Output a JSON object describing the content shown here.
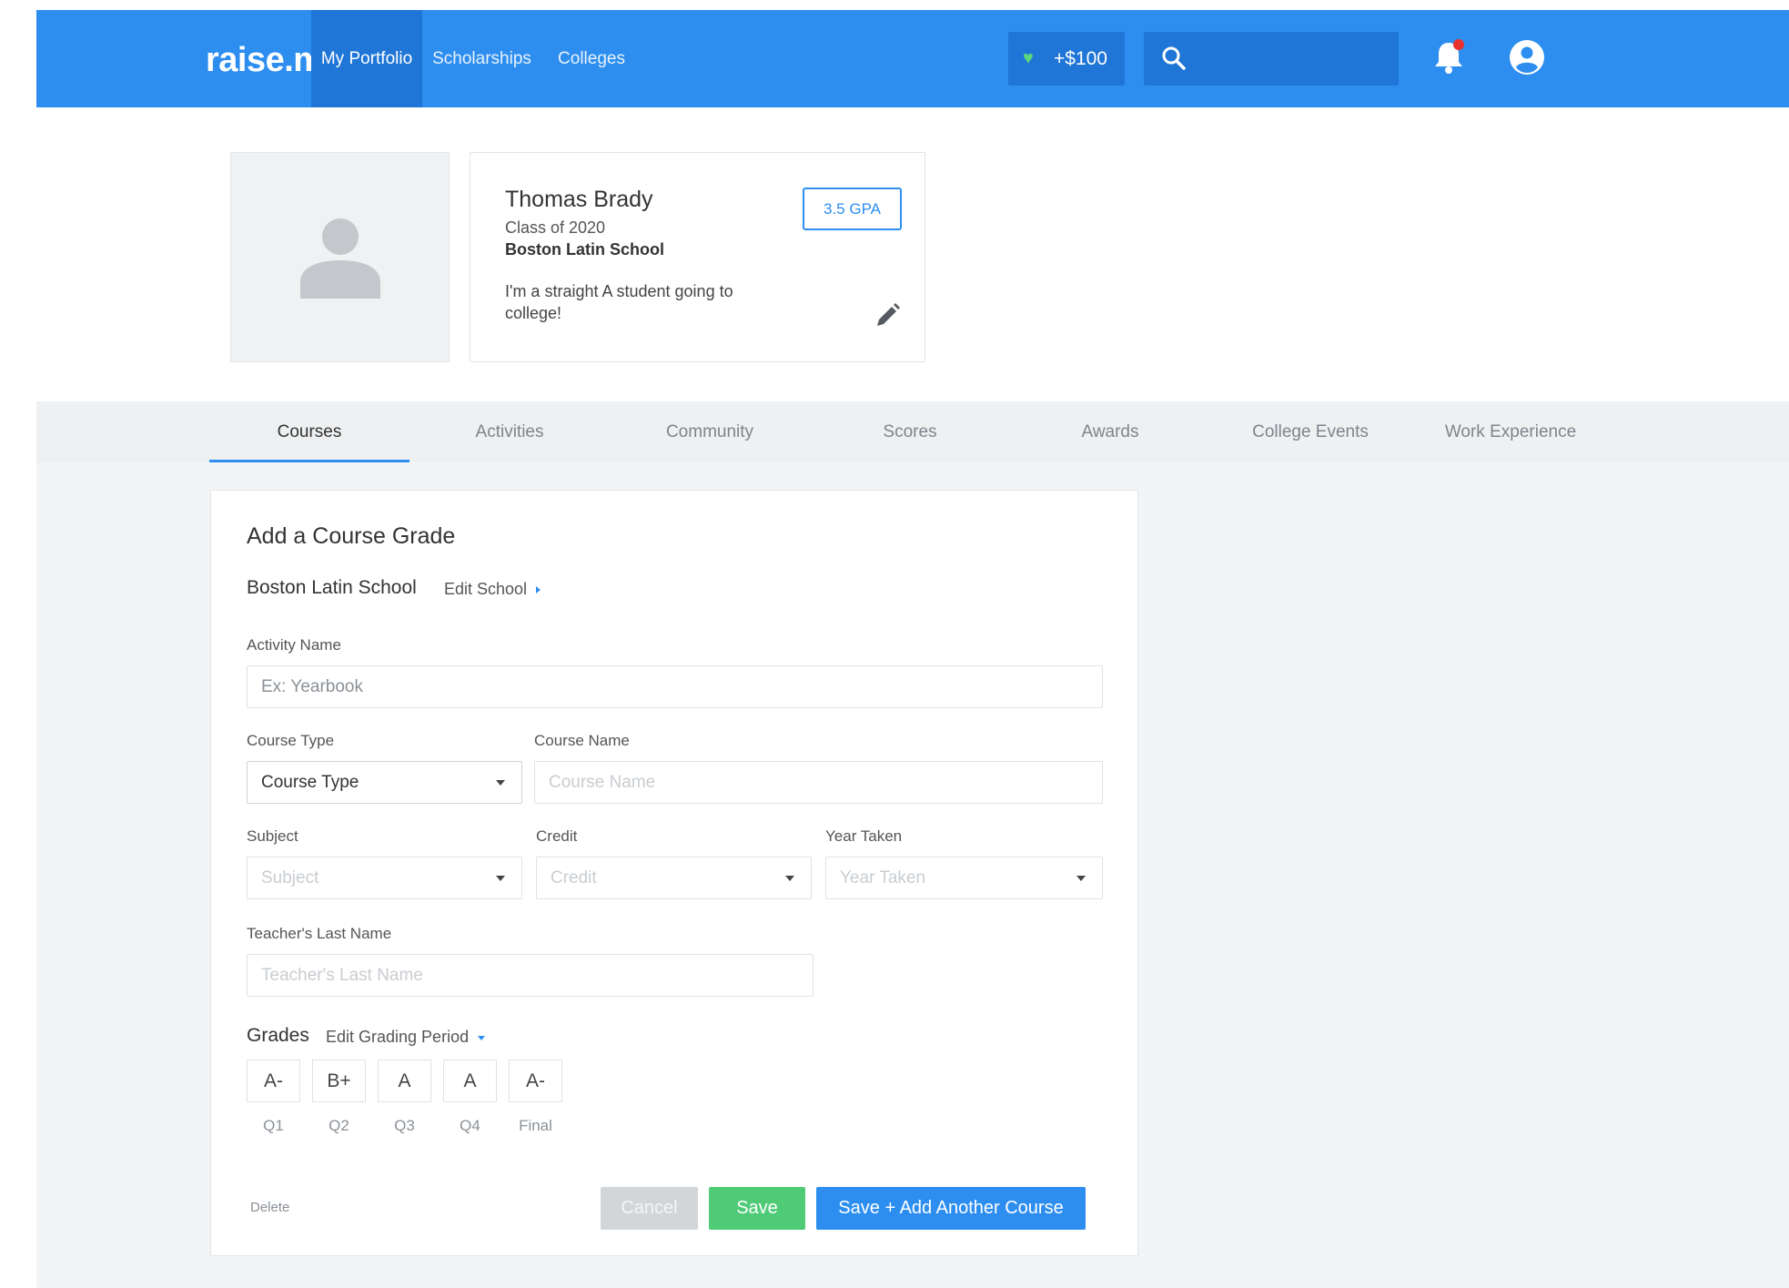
{
  "nav": {
    "logo": "raise.me",
    "links": [
      "My Portfolio",
      "Scholarships",
      "Colleges"
    ],
    "reward": "+$100"
  },
  "profile": {
    "name": "Thomas Brady",
    "class_of": "Class of 2020",
    "school": "Boston Latin School",
    "bio": "I'm a straight A student going to college!",
    "gpa": "3.5 GPA"
  },
  "tabs": [
    "Courses",
    "Activities",
    "Community",
    "Scores",
    "Awards",
    "College Events",
    "Work Experience"
  ],
  "form": {
    "title": "Add a Course Grade",
    "school": "Boston Latin School",
    "edit_school": "Edit School",
    "activity_name": {
      "label": "Activity Name",
      "placeholder": "Ex: Yearbook"
    },
    "course_type": {
      "label": "Course Type",
      "value": "Course Type"
    },
    "course_name": {
      "label": "Course Name",
      "placeholder": "Course Name"
    },
    "subject": {
      "label": "Subject",
      "value": "Subject"
    },
    "credit": {
      "label": "Credit",
      "value": "Credit"
    },
    "year_taken": {
      "label": "Year Taken",
      "value": "Year Taken"
    },
    "teacher": {
      "label": "Teacher's Last Name",
      "placeholder": "Teacher's Last Name"
    },
    "grades_title": "Grades",
    "grades_edit": "Edit Grading Period",
    "grades": [
      {
        "value": "A-",
        "period": "Q1"
      },
      {
        "value": "B+",
        "period": "Q2"
      },
      {
        "value": "A",
        "period": "Q3"
      },
      {
        "value": "A",
        "period": "Q4"
      },
      {
        "value": "A-",
        "period": "Final"
      }
    ],
    "delete": "Delete",
    "cancel": "Cancel",
    "save": "Save",
    "save_add": "Save + Add Another Course"
  },
  "colors": {
    "brand_blue": "#2d8ef0",
    "nav_active": "#1f76d6",
    "save_green": "#4fcb77",
    "notification_dot": "#e8322f"
  },
  "icons": [
    "heart-icon",
    "search-icon",
    "bell-icon",
    "user-icon",
    "avatar-placeholder-icon",
    "pencil-icon"
  ]
}
